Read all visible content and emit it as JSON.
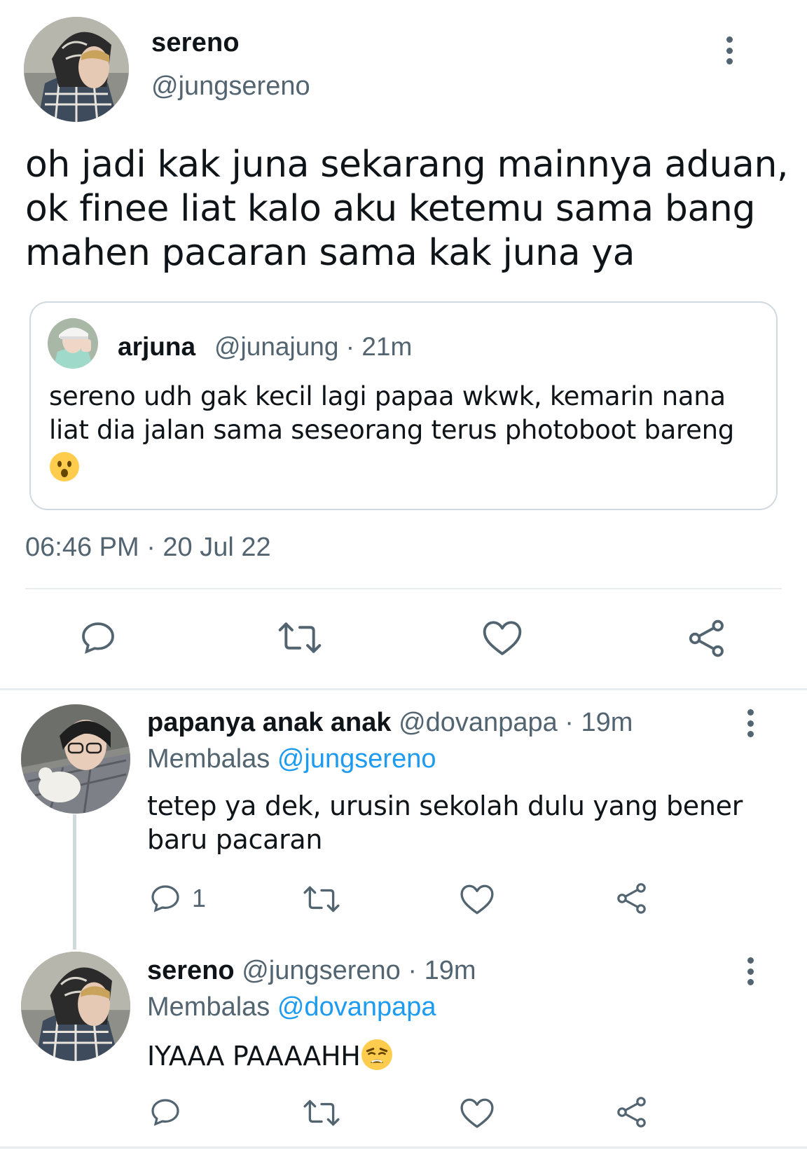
{
  "main_tweet": {
    "name": "sereno",
    "handle": "@jungsereno",
    "text": "oh jadi kak juna sekarang mainnya aduan, ok finee liat kalo aku ketemu sama bang mahen pacaran sama kak juna ya",
    "timestamp": "06:46 PM · 20 Jul 22",
    "quoted": {
      "name": "arjuna",
      "handle": "@junajung · 21m",
      "text": "sereno udh gak kecil lagi papaa wkwk, kemarin nana liat dia jalan sama seseorang terus photoboot bareng",
      "emoji": "hushed-face-emoji"
    },
    "actions": [
      "reply-icon",
      "retweet-icon",
      "like-icon",
      "share-icon"
    ]
  },
  "replies": [
    {
      "name": "papanya anak anak",
      "handle": "@dovanpapa · 19m",
      "replying_prefix": "Membalas",
      "replying_to": "@jungsereno",
      "text": "tetep ya dek, urusin sekolah dulu yang bener baru pacaran",
      "reply_count": "1"
    },
    {
      "name": "sereno",
      "handle": "@jungsereno · 19m",
      "replying_prefix": "Membalas",
      "replying_to": "@dovanpapa",
      "text": "IYAAA PAAAAHH",
      "emoji": "weary-face-emoji",
      "reply_count": ""
    }
  ],
  "colors": {
    "text": "#0f1419",
    "secondary": "#536471",
    "link": "#1d9bf0",
    "border": "#cfd9de"
  }
}
